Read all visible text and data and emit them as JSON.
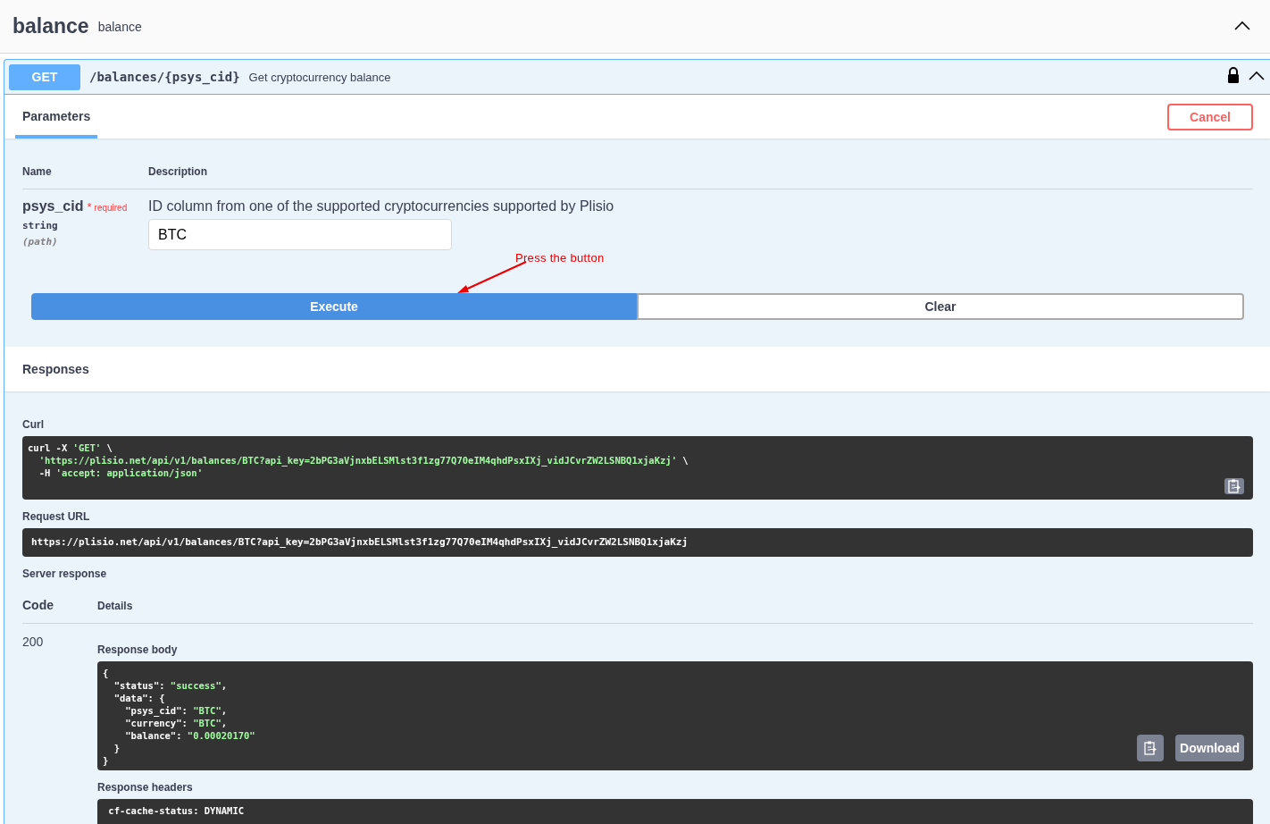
{
  "header": {
    "title": "balance",
    "subtitle": "balance",
    "expanded": true
  },
  "operation": {
    "method": "GET",
    "path": "/balances/{psys_cid}",
    "summary": "Get cryptocurrency balance",
    "locked": true,
    "expanded": true,
    "tabs": [
      {
        "label": "Parameters",
        "selected": true
      }
    ],
    "cancel": "Cancel",
    "param_columns": [
      "Name",
      "Description"
    ],
    "parameters": [
      {
        "name": "psys_cid",
        "required": true,
        "required_mark": "*",
        "required_label": "required",
        "type": "string",
        "location": "(path)",
        "description": "ID column from one of the supported cryptocurrencies supported by Plisio",
        "value": "BTC"
      }
    ],
    "annotation": "Press the button",
    "execute": "Execute",
    "clear": "Clear",
    "responses_title": "Responses",
    "curl": {
      "label": "Curl",
      "lines": [
        [
          {
            "kind": "plain",
            "text": "curl -X "
          },
          {
            "kind": "string",
            "text": "'GET'"
          },
          {
            "kind": "plain",
            "text": " \\"
          }
        ],
        [
          {
            "kind": "string",
            "text": "  'https://plisio.net/api/v1/balances/BTC?api_key=2bPG3aVjnxbELSMlst3f1zg77Q70eIM4qhdPsxIXj_vidJCvrZW2LSNBQ1xjaKzj'"
          },
          {
            "kind": "plain",
            "text": " \\"
          }
        ],
        [
          {
            "kind": "plain",
            "text": "  -H "
          },
          {
            "kind": "string",
            "text": "'accept: application/json'"
          }
        ]
      ]
    },
    "request_url": {
      "label": "Request URL",
      "value": "https://plisio.net/api/v1/balances/BTC?api_key=2bPG3aVjnxbELSMlst3f1zg77Q70eIM4qhdPsxIXj_vidJCvrZW2LSNBQ1xjaKzj"
    },
    "server_response": {
      "label": "Server response",
      "columns": [
        "Code",
        "Details"
      ],
      "code": "200",
      "body_label": "Response body",
      "body_lines": [
        [
          {
            "kind": "plain",
            "text": "{"
          }
        ],
        [
          {
            "kind": "plain",
            "text": "  \"status\": "
          },
          {
            "kind": "string",
            "text": "\"success\""
          },
          {
            "kind": "plain",
            "text": ","
          }
        ],
        [
          {
            "kind": "plain",
            "text": "  \"data\": {"
          }
        ],
        [
          {
            "kind": "plain",
            "text": "    \"psys_cid\": "
          },
          {
            "kind": "string",
            "text": "\"BTC\""
          },
          {
            "kind": "plain",
            "text": ","
          }
        ],
        [
          {
            "kind": "plain",
            "text": "    \"currency\": "
          },
          {
            "kind": "string",
            "text": "\"BTC\""
          },
          {
            "kind": "plain",
            "text": ","
          }
        ],
        [
          {
            "kind": "plain",
            "text": "    \"balance\": "
          },
          {
            "kind": "string",
            "text": "\"0.00020170\""
          }
        ],
        [
          {
            "kind": "plain",
            "text": "  }"
          }
        ],
        [
          {
            "kind": "plain",
            "text": "}"
          }
        ]
      ],
      "download": "Download",
      "headers_label": "Response headers",
      "headers_lines": [
        [
          {
            "kind": "plain",
            "text": " cf-cache-status: DYNAMIC"
          }
        ]
      ]
    }
  }
}
